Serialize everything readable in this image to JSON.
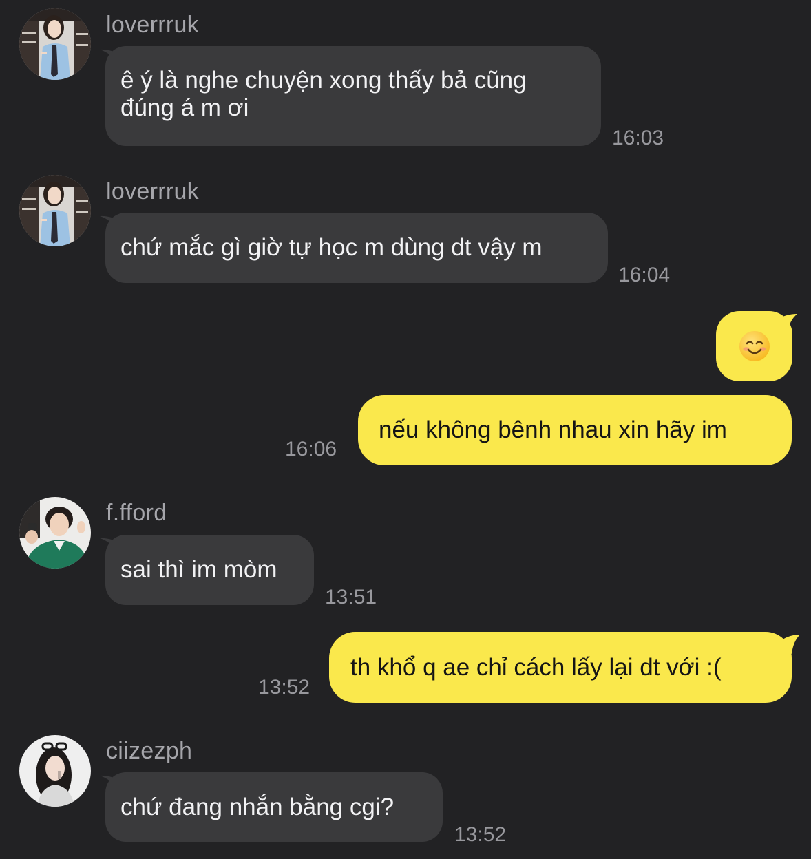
{
  "messages": [
    {
      "sender": "loverrruk",
      "text_lines": [
        "ê ý là nghe chuyện xong thấy bả cũng",
        "đúng á m ơi"
      ],
      "time": "16:03",
      "direction": "incoming"
    },
    {
      "sender": "loverrruk",
      "text": "chứ mắc gì giờ tự học m dùng dt vậy m",
      "time": "16:04",
      "direction": "incoming"
    },
    {
      "emoji": "smiling-face-emoji",
      "direction": "outgoing"
    },
    {
      "text": "nếu không bênh nhau xin hãy im",
      "time": "16:06",
      "direction": "outgoing"
    },
    {
      "sender": "f.fford",
      "text": "sai thì im mòm",
      "time": "13:51",
      "direction": "incoming"
    },
    {
      "text": "th khổ q ae chỉ cách lấy lại dt với :(",
      "time": "13:52",
      "direction": "outgoing"
    },
    {
      "sender": "ciizezph",
      "text": "chứ đang nhắn bằng cgi?",
      "time": "13:52",
      "direction": "incoming"
    }
  ],
  "colors": {
    "background": "#222224",
    "incoming_bubble": "#3a3a3c",
    "outgoing_bubble": "#fae84c",
    "incoming_text": "#f2f2f4",
    "outgoing_text": "#151515",
    "meta_text": "#a6a6ab"
  }
}
